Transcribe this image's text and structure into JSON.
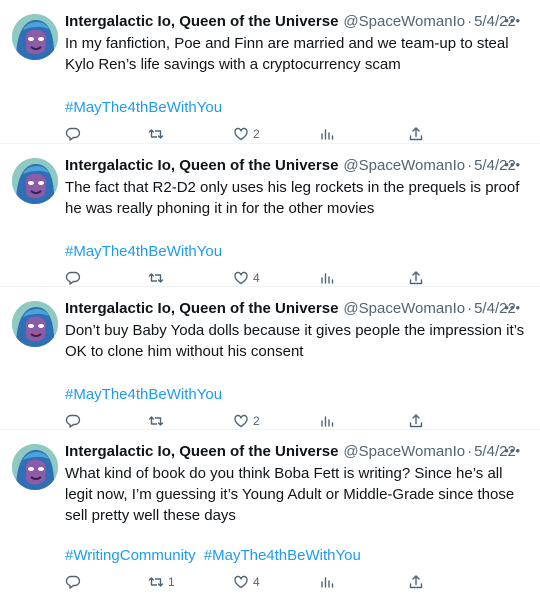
{
  "tweets": [
    {
      "author": "Intergalactic Io, Queen of the Universe",
      "handle": "@SpaceWomanIo",
      "separator": "·",
      "date": "5/4/22",
      "text": "In my fanfiction, Poe and Finn are married and we team-up to steal Kylo Ren’s life savings with a cryptocurrency scam",
      "hashtags": [
        "#MayThe4thBeWithYou"
      ],
      "replies": "",
      "retweets": "",
      "likes": "2"
    },
    {
      "author": "Intergalactic Io, Queen of the Universe",
      "handle": "@SpaceWomanIo",
      "separator": "·",
      "date": "5/4/22",
      "text": "The fact that R2-D2 only uses his leg rockets in the prequels is proof he was really phoning it in for the other movies",
      "hashtags": [
        "#MayThe4thBeWithYou"
      ],
      "replies": "",
      "retweets": "",
      "likes": "4"
    },
    {
      "author": "Intergalactic Io, Queen of the Universe",
      "handle": "@SpaceWomanIo",
      "separator": "·",
      "date": "5/4/22",
      "text": "Don’t buy Baby Yoda dolls because it gives people the impression it’s OK to clone him without his consent",
      "hashtags": [
        "#MayThe4thBeWithYou"
      ],
      "replies": "",
      "retweets": "",
      "likes": "2"
    },
    {
      "author": "Intergalactic Io, Queen of the Universe",
      "handle": "@SpaceWomanIo",
      "separator": "·",
      "date": "5/4/22",
      "text": "What kind of book do you think Boba Fett is writing? Since he’s all legit now, I’m guessing it’s Young Adult or Middle-Grade since those sell pretty well these days",
      "hashtags": [
        "#WritingCommunity",
        "#MayThe4thBeWithYou"
      ],
      "replies": "",
      "retweets": "1",
      "likes": "4"
    }
  ],
  "icons": {
    "more": "more-icon",
    "reply": "reply-icon",
    "retweet": "retweet-icon",
    "like": "heart-icon",
    "views": "views-icon",
    "share": "share-icon"
  },
  "colors": {
    "hashtag": "#1d9bf0",
    "muted": "#536471",
    "text": "#0f1419",
    "divider": "#eff3f4"
  }
}
